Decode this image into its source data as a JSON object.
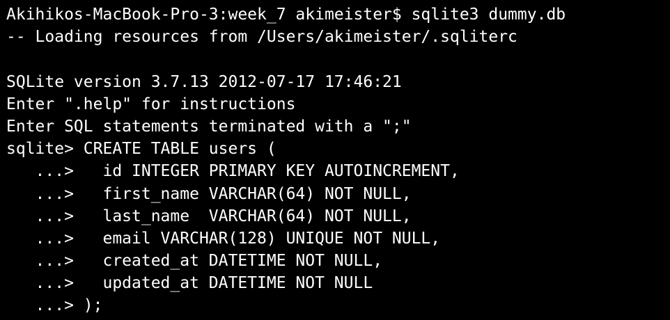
{
  "terminal": {
    "lines": [
      "Akihikos-MacBook-Pro-3:week_7 akimeister$ sqlite3 dummy.db",
      "-- Loading resources from /Users/akimeister/.sqliterc",
      "",
      "SQLite version 3.7.13 2012-07-17 17:46:21",
      "Enter \".help\" for instructions",
      "Enter SQL statements terminated with a \";\"",
      "sqlite> CREATE TABLE users (",
      "   ...>   id INTEGER PRIMARY KEY AUTOINCREMENT,",
      "   ...>   first_name VARCHAR(64) NOT NULL,",
      "   ...>   last_name  VARCHAR(64) NOT NULL,",
      "   ...>   email VARCHAR(128) UNIQUE NOT NULL,",
      "   ...>   created_at DATETIME NOT NULL,",
      "   ...>   updated_at DATETIME NOT NULL",
      "   ...> );"
    ]
  }
}
